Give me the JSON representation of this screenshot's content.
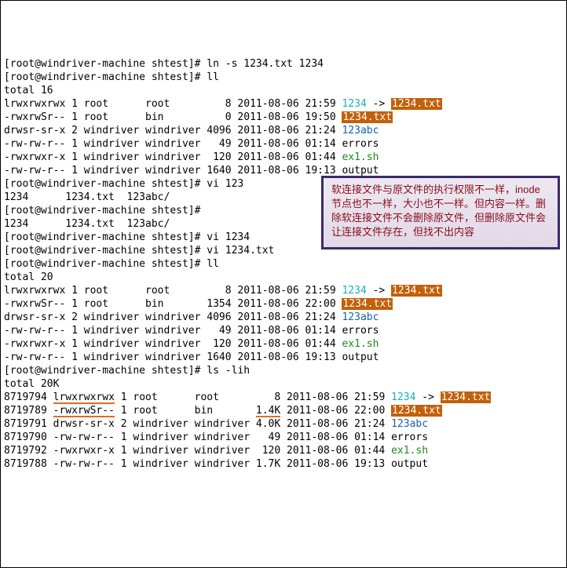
{
  "prompt": "[root@windriver-machine shtest]#",
  "cmds": {
    "c1": "ln -s 1234.txt 1234",
    "c2": "ll",
    "c3": "vi 123",
    "c4": "vi 1234",
    "c5": "vi 1234.txt",
    "c6": "ll",
    "c7": "ls -lih"
  },
  "totals": {
    "t16": "total 16",
    "t20": "total 20",
    "t20k": "total 20K"
  },
  "arrow": " -> ",
  "note": "软连接文件与原文件的执行权限不一样，inode节点也不一样，大小也不一样。但内容一样。删除软连接文件不会删除原文件，但删除原文件会让连接文件存在，但找不出内容",
  "ls1": {
    "link": {
      "perm": "lrwxrwxrwx 1 root      root         8 2011-08-06 21:59 ",
      "name": "1234",
      "target": "1234.txt"
    },
    "txt": {
      "perm": "-rwxrwSr-- 1 root      bin          0 2011-08-06 19:50 ",
      "name": "1234.txt"
    },
    "dir": {
      "perm": "drwsr-sr-x 2 windriver windriver 4096 2011-08-06 21:24 ",
      "name": "123abc"
    },
    "err": {
      "perm": "-rw-rw-r-- 1 windriver windriver   49 2011-08-06 01:14 errors"
    },
    "ex1": {
      "perm": "-rwxrwxr-x 1 windriver windriver  120 2011-08-06 01:44 ",
      "name": "ex1.sh"
    },
    "out": {
      "perm": "-rw-rw-r-- 1 windriver windriver 1640 2011-08-06 19:13 output"
    }
  },
  "short1": "1234      1234.txt  123abc/",
  "short2": "1234      1234.txt  123abc/",
  "ls2": {
    "link": {
      "perm": "lrwxrwxrwx 1 root      root         8 2011-08-06 21:59 ",
      "name": "1234",
      "target": "1234.txt"
    },
    "txt": {
      "perm": "-rwxrwSr-- 1 root      bin       1354 2011-08-06 22:00 ",
      "name": "1234.txt"
    },
    "dir": {
      "perm": "drwsr-sr-x 2 windriver windriver 4096 2011-08-06 21:24 ",
      "name": "123abc"
    },
    "err": {
      "perm": "-rw-rw-r-- 1 windriver windriver   49 2011-08-06 01:14 errors"
    },
    "ex1": {
      "perm": "-rwxrwxr-x 1 windriver windriver  120 2011-08-06 01:44 ",
      "name": "ex1.sh"
    },
    "out": {
      "perm": "-rw-rw-r-- 1 windriver windriver 1640 2011-08-06 19:13 output"
    }
  },
  "ls3": {
    "link": {
      "ino": "8719794 ",
      "perm": "lrwxrwxrwx",
      "rest": " 1 root      root         8 2011-08-06 21:59 ",
      "name": "1234",
      "target": "1234.txt"
    },
    "txt": {
      "ino": "8719789 ",
      "perm": "-rwxrwSr--",
      "mid": " 1 root      bin       ",
      "size": "1.4K",
      "rest2": " 2011-08-06 22:00 ",
      "name": "1234.txt"
    },
    "dir": {
      "row": "8719791 drwsr-sr-x 2 windriver windriver 4.0K 2011-08-06 21:24 ",
      "name": "123abc"
    },
    "err": {
      "row": "8719790 -rw-rw-r-- 1 windriver windriver   49 2011-08-06 01:14 errors"
    },
    "ex1": {
      "row": "8719792 -rwxrwxr-x 1 windriver windriver  120 2011-08-06 01:44 ",
      "name": "ex1.sh"
    },
    "out": {
      "row": "8719788 -rw-rw-r-- 1 windriver windriver 1.7K 2011-08-06 19:13 output"
    }
  }
}
